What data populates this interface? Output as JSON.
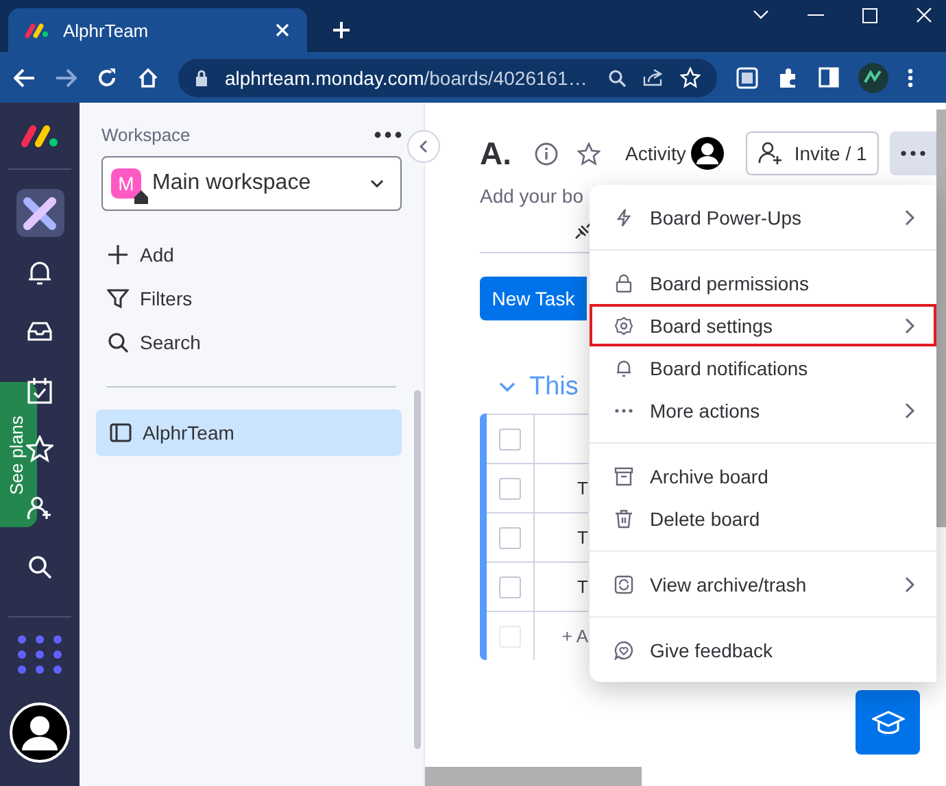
{
  "browser": {
    "tab_title": "AlphrTeam",
    "url_host": "alphrteam.monday.com",
    "url_path": "/boards/4026161…"
  },
  "rail": {
    "see_plans": "See plans",
    "items": [
      {
        "selected": true
      },
      {
        "selected": false
      },
      {
        "selected": false
      },
      {
        "selected": false
      },
      {
        "selected": false
      },
      {
        "selected": false
      },
      {
        "selected": false
      }
    ]
  },
  "workspace": {
    "label": "Workspace",
    "avatar": "M",
    "name": "Main workspace",
    "actions": [
      "Add",
      "Filters",
      "Search"
    ],
    "boards": [
      {
        "label": "AlphrTeam",
        "selected": true
      }
    ]
  },
  "board": {
    "title": "A.",
    "activity": "Activity",
    "invite": "Invite / 1",
    "description": "Add your bo",
    "new_task": "New Task",
    "group_title": "This",
    "rows": [
      {
        "text": "",
        "checked": false
      },
      {
        "text": "T",
        "checked": false
      },
      {
        "text": "T",
        "checked": false
      },
      {
        "text": "T",
        "checked": false
      }
    ],
    "add_row": {
      "text": "+ A",
      "checked": false
    }
  },
  "menu": {
    "sections": [
      [
        {
          "label": "Board Power-Ups",
          "submenu": true,
          "highlighted": false
        }
      ],
      [
        {
          "label": "Board permissions",
          "submenu": false,
          "highlighted": false
        },
        {
          "label": "Board settings",
          "submenu": true,
          "highlighted": true
        },
        {
          "label": "Board notifications",
          "submenu": false,
          "highlighted": false
        },
        {
          "label": "More actions",
          "submenu": true,
          "highlighted": false
        }
      ],
      [
        {
          "label": "Archive board",
          "submenu": false,
          "highlighted": false
        },
        {
          "label": "Delete board",
          "submenu": false,
          "highlighted": false
        }
      ],
      [
        {
          "label": "View archive/trash",
          "submenu": true,
          "highlighted": false
        }
      ],
      [
        {
          "label": "Give feedback",
          "submenu": false,
          "highlighted": false
        }
      ]
    ]
  }
}
